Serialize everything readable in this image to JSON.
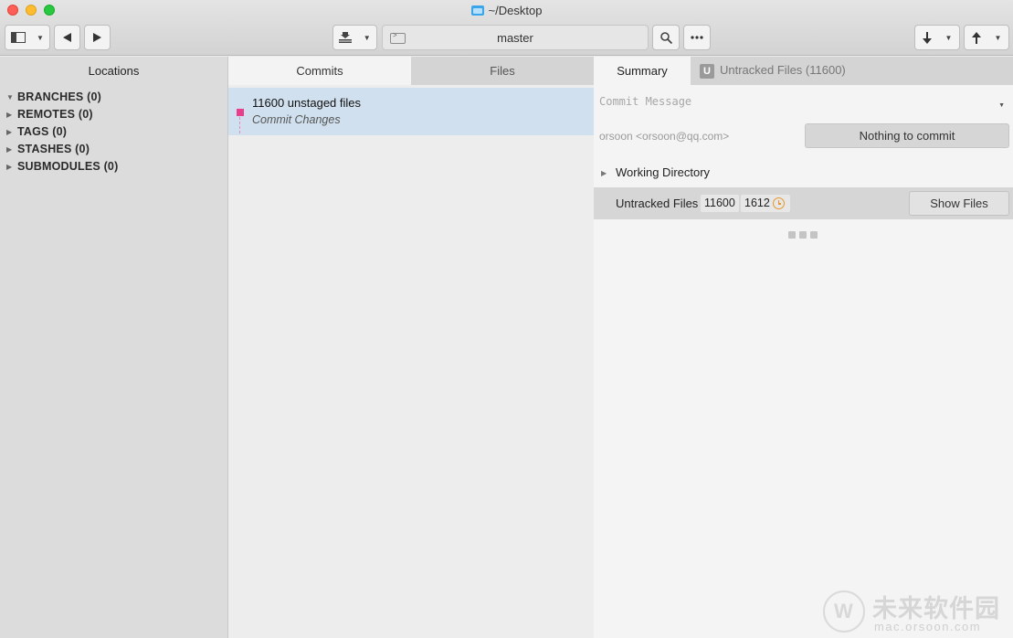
{
  "window": {
    "title": "~/Desktop"
  },
  "toolbar": {
    "branch": "master"
  },
  "sidebar": {
    "header": "Locations",
    "items": [
      {
        "label": "BRANCHES (0)",
        "expanded": true
      },
      {
        "label": "REMOTES (0)",
        "expanded": false
      },
      {
        "label": "TAGS (0)",
        "expanded": false
      },
      {
        "label": "STASHES (0)",
        "expanded": false
      },
      {
        "label": "SUBMODULES (0)",
        "expanded": false
      }
    ]
  },
  "commits_pane": {
    "tabs": [
      {
        "label": "Commits",
        "active": true
      },
      {
        "label": "Files",
        "active": false
      }
    ],
    "rows": [
      {
        "title": "11600 unstaged files",
        "subtitle": "Commit Changes",
        "dot_color": "#e83e8c"
      }
    ]
  },
  "detail_pane": {
    "tabs": {
      "summary": "Summary",
      "untracked_badge": "U",
      "untracked": "Untracked Files (11600)"
    },
    "commit_message_placeholder": "Commit Message",
    "author": "orsoon <orsoon@qq.com>",
    "nothing_to_commit": "Nothing to commit",
    "working_directory": "Working Directory",
    "untracked_row": {
      "label": "Untracked Files",
      "count": "11600",
      "pending": "1612",
      "show_files": "Show Files"
    }
  },
  "watermark": {
    "text": "未来软件园",
    "site": "mac.orsoon.com"
  }
}
